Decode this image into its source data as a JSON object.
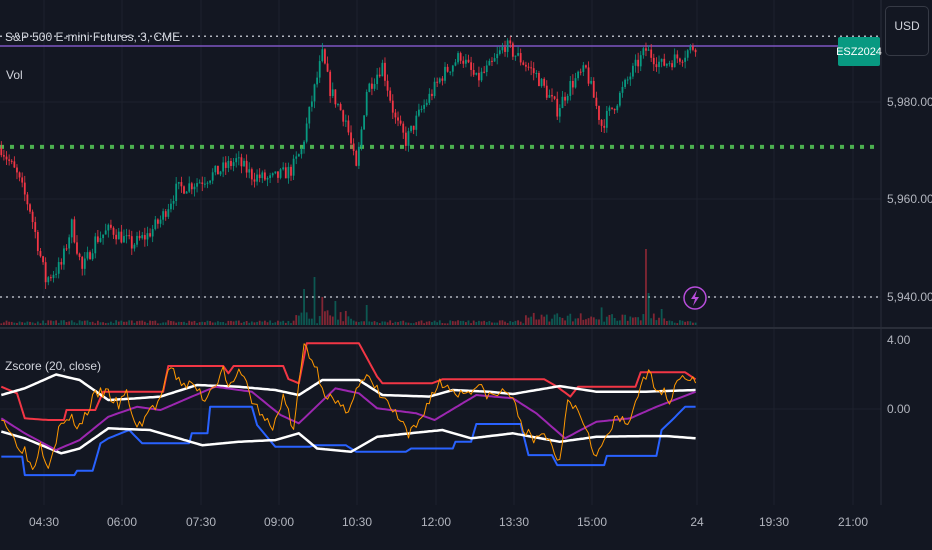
{
  "header": {
    "symbol_legend": "S&P 500 E-mini Futures, 3, CME",
    "volume_legend": "Vol",
    "indicator_legend": "Zscore (20, close)"
  },
  "symbol_tag": "ESZ2024",
  "currency_button": "USD",
  "colors": {
    "up": "#089981",
    "down": "#f23645",
    "upper": "#f23645",
    "lower": "#2962ff",
    "band": "#ffffff",
    "mean": "#9c27b0",
    "zscore": "#ff9800",
    "level": "#4caf50",
    "background": "#131722"
  },
  "price_axis": {
    "labels": [
      "5,980.00",
      "5,960.00",
      "5,940.00"
    ]
  },
  "zscore_axis": {
    "labels": [
      "4.00",
      "0.00"
    ]
  },
  "time_axis": {
    "labels": [
      "04:30",
      "06:00",
      "07:30",
      "09:00",
      "10:30",
      "12:00",
      "13:30",
      "15:00",
      "24",
      "19:30",
      "21:00"
    ]
  },
  "chart_data": [
    {
      "type": "candlestick",
      "title": "S&P 500 E-mini Futures, 3, CME",
      "x_unit": "3-minute bar index",
      "ylim": [
        5932,
        5998
      ],
      "close_keypoints": [
        [
          0,
          5970.6
        ],
        [
          6,
          5965
        ],
        [
          11,
          5958
        ],
        [
          17,
          5943.5
        ],
        [
          23,
          5946.6
        ],
        [
          27,
          5954.8
        ],
        [
          31,
          5945.5
        ],
        [
          36,
          5951.7
        ],
        [
          42,
          5954
        ],
        [
          50,
          5950.7
        ],
        [
          56,
          5952.7
        ],
        [
          61,
          5955.8
        ],
        [
          67,
          5962
        ],
        [
          77,
          5964
        ],
        [
          84,
          5966
        ],
        [
          90,
          5968
        ],
        [
          96,
          5965
        ],
        [
          103,
          5964
        ],
        [
          111,
          5966
        ],
        [
          115,
          5970
        ],
        [
          119,
          5980.4
        ],
        [
          123,
          5989.6
        ],
        [
          126,
          5982.5
        ],
        [
          132,
          5976.3
        ],
        [
          136,
          5966
        ],
        [
          140,
          5982.5
        ],
        [
          146,
          5987.6
        ],
        [
          151,
          5976.3
        ],
        [
          155,
          5972
        ],
        [
          161,
          5978.4
        ],
        [
          169,
          5985.5
        ],
        [
          176,
          5989.6
        ],
        [
          182,
          5984.5
        ],
        [
          188,
          5987.6
        ],
        [
          193,
          5991.7
        ],
        [
          199,
          5988.7
        ],
        [
          205,
          5985.5
        ],
        [
          213,
          5978.4
        ],
        [
          218,
          5983.5
        ],
        [
          224,
          5986.6
        ],
        [
          230,
          5975.3
        ],
        [
          236,
          5980.4
        ],
        [
          241,
          5985.5
        ],
        [
          247,
          5990.7
        ],
        [
          253,
          5987.6
        ],
        [
          261,
          5989.6
        ],
        [
          266,
          5991.7
        ]
      ],
      "horizontal_levels": [
        {
          "price": 5993.5,
          "style": "dotted",
          "color": "#b2b5be"
        },
        {
          "price": 5991.5,
          "style": "solid",
          "color": "#7e57c2"
        },
        {
          "price": 5970.8,
          "style": "dotted",
          "color": "#4caf50"
        },
        {
          "price": 5940.0,
          "style": "dotted",
          "color": "#b2b5be"
        }
      ],
      "volume_spikes": [
        [
          116,
          0.45
        ],
        [
          120,
          0.6
        ],
        [
          123,
          0.35
        ],
        [
          128,
          0.3
        ],
        [
          140,
          0.25
        ],
        [
          230,
          0.22
        ],
        [
          247,
          0.95
        ],
        [
          248,
          0.4
        ],
        [
          253,
          0.2
        ]
      ]
    },
    {
      "type": "line",
      "title": "Zscore (20, close)",
      "ylim": [
        -5.5,
        4.5
      ],
      "series": [
        {
          "name": "upper",
          "points": [
            [
              0,
              1.29
            ],
            [
              6,
              0.91
            ],
            [
              9,
              -0.54
            ],
            [
              18,
              -0.64
            ],
            [
              24,
              -0.64
            ],
            [
              25,
              -0.06
            ],
            [
              36,
              -0.06
            ],
            [
              39,
              1.0
            ],
            [
              62,
              1.0
            ],
            [
              64,
              2.49
            ],
            [
              85,
              2.49
            ],
            [
              87,
              2.07
            ],
            [
              89,
              2.49
            ],
            [
              108,
              2.49
            ],
            [
              110,
              1.74
            ],
            [
              114,
              1.49
            ],
            [
              117,
              3.81
            ],
            [
              137,
              3.81
            ],
            [
              144,
              1.88
            ],
            [
              146,
              1.49
            ],
            [
              165,
              1.49
            ],
            [
              169,
              1.72
            ],
            [
              208,
              1.72
            ],
            [
              213,
              1.29
            ],
            [
              218,
              0.72
            ],
            [
              221,
              1.29
            ],
            [
              243,
              1.29
            ],
            [
              245,
              2.13
            ],
            [
              262,
              2.13
            ],
            [
              266,
              1.72
            ]
          ]
        },
        {
          "name": "lower",
          "points": [
            [
              0,
              -2.76
            ],
            [
              8,
              -2.76
            ],
            [
              9,
              -3.83
            ],
            [
              28,
              -3.83
            ],
            [
              29,
              -3.58
            ],
            [
              35,
              -3.58
            ],
            [
              38,
              -1.99
            ],
            [
              41,
              -1.7
            ],
            [
              49,
              -1.22
            ],
            [
              54,
              -1.99
            ],
            [
              72,
              -1.99
            ],
            [
              73,
              -1.41
            ],
            [
              79,
              -1.41
            ],
            [
              80,
              0.13
            ],
            [
              96,
              0.13
            ],
            [
              98,
              -0.93
            ],
            [
              105,
              -2.19
            ],
            [
              118,
              -2.19
            ],
            [
              120,
              -2.1
            ],
            [
              132,
              -2.1
            ],
            [
              136,
              -2.48
            ],
            [
              155,
              -2.48
            ],
            [
              157,
              -2.29
            ],
            [
              173,
              -2.29
            ],
            [
              174,
              -1.9
            ],
            [
              180,
              -1.9
            ],
            [
              182,
              -0.87
            ],
            [
              199,
              -0.87
            ],
            [
              202,
              -2.67
            ],
            [
              211,
              -2.67
            ],
            [
              213,
              -3.25
            ],
            [
              231,
              -3.25
            ],
            [
              232,
              -2.72
            ],
            [
              251,
              -2.72
            ],
            [
              253,
              -1.22
            ],
            [
              257,
              -0.64
            ],
            [
              262,
              0.13
            ],
            [
              266,
              0.13
            ]
          ]
        },
        {
          "name": "upper_band",
          "points": [
            [
              0,
              0.81
            ],
            [
              9,
              1.2
            ],
            [
              21,
              2.0
            ],
            [
              30,
              1.68
            ],
            [
              41,
              0.52
            ],
            [
              52,
              0.62
            ],
            [
              61,
              0.72
            ],
            [
              75,
              1.39
            ],
            [
              91,
              1.29
            ],
            [
              105,
              1.1
            ],
            [
              114,
              0.81
            ],
            [
              123,
              1.68
            ],
            [
              137,
              1.68
            ],
            [
              146,
              0.81
            ],
            [
              164,
              0.72
            ],
            [
              173,
              1.1
            ],
            [
              187,
              1.0
            ],
            [
              196,
              0.87
            ],
            [
              205,
              1.1
            ],
            [
              214,
              1.33
            ],
            [
              228,
              1.0
            ],
            [
              246,
              1.0
            ],
            [
              266,
              1.1
            ]
          ]
        },
        {
          "name": "lower_band",
          "points": [
            [
              0,
              -1.31
            ],
            [
              9,
              -1.7
            ],
            [
              23,
              -2.57
            ],
            [
              30,
              -2.29
            ],
            [
              41,
              -1.12
            ],
            [
              57,
              -1.22
            ],
            [
              68,
              -1.7
            ],
            [
              77,
              -2.1
            ],
            [
              91,
              -1.9
            ],
            [
              105,
              -1.8
            ],
            [
              114,
              -1.41
            ],
            [
              121,
              -2.29
            ],
            [
              134,
              -2.48
            ],
            [
              144,
              -1.61
            ],
            [
              159,
              -1.37
            ],
            [
              169,
              -1.22
            ],
            [
              180,
              -1.7
            ],
            [
              196,
              -1.41
            ],
            [
              214,
              -1.9
            ],
            [
              228,
              -1.61
            ],
            [
              246,
              -1.57
            ],
            [
              255,
              -1.57
            ],
            [
              266,
              -1.7
            ]
          ]
        },
        {
          "name": "mean",
          "points": [
            [
              0,
              -0.54
            ],
            [
              9,
              -1.41
            ],
            [
              21,
              -2.38
            ],
            [
              30,
              -1.8
            ],
            [
              41,
              -0.45
            ],
            [
              52,
              0.13
            ],
            [
              61,
              -0.06
            ],
            [
              73,
              0.72
            ],
            [
              82,
              1.29
            ],
            [
              96,
              1.0
            ],
            [
              107,
              -0.35
            ],
            [
              114,
              -0.83
            ],
            [
              128,
              1.2
            ],
            [
              137,
              0.91
            ],
            [
              144,
              0.04
            ],
            [
              159,
              -0.25
            ],
            [
              166,
              -0.64
            ],
            [
              182,
              0.81
            ],
            [
              196,
              0.62
            ],
            [
              205,
              -0.25
            ],
            [
              216,
              -1.7
            ],
            [
              228,
              -0.74
            ],
            [
              241,
              -0.54
            ],
            [
              251,
              0.13
            ],
            [
              266,
              1.0
            ]
          ]
        },
        {
          "name": "zscore",
          "points": [
            [
              0,
              -0.3
            ],
            [
              5,
              -1.8
            ],
            [
              9,
              -2.4
            ],
            [
              12,
              -3.5
            ],
            [
              15,
              -2.0
            ],
            [
              18,
              -3.2
            ],
            [
              22,
              -1.2
            ],
            [
              26,
              -0.5
            ],
            [
              30,
              -1.0
            ],
            [
              36,
              0.8
            ],
            [
              40,
              1.0
            ],
            [
              45,
              0.2
            ],
            [
              48,
              0.9
            ],
            [
              52,
              -1.2
            ],
            [
              56,
              -0.2
            ],
            [
              60,
              0.3
            ],
            [
              63,
              1.5
            ],
            [
              65,
              2.4
            ],
            [
              68,
              1.6
            ],
            [
              74,
              1.3
            ],
            [
              78,
              0.6
            ],
            [
              82,
              1.6
            ],
            [
              85,
              2.2
            ],
            [
              88,
              1.2
            ],
            [
              92,
              2.3
            ],
            [
              96,
              0.5
            ],
            [
              100,
              -0.4
            ],
            [
              104,
              -1.2
            ],
            [
              108,
              0.8
            ],
            [
              112,
              -1.3
            ],
            [
              116,
              3.8
            ],
            [
              120,
              2.6
            ],
            [
              124,
              1.0
            ],
            [
              128,
              0.3
            ],
            [
              132,
              -0.2
            ],
            [
              136,
              1.2
            ],
            [
              140,
              1.8
            ],
            [
              146,
              0.7
            ],
            [
              152,
              -0.5
            ],
            [
              156,
              -1.6
            ],
            [
              160,
              -0.8
            ],
            [
              164,
              0.6
            ],
            [
              168,
              1.5
            ],
            [
              172,
              1.2
            ],
            [
              176,
              0.9
            ],
            [
              182,
              1.3
            ],
            [
              188,
              0.7
            ],
            [
              194,
              1.1
            ],
            [
              200,
              -1.0
            ],
            [
              204,
              -2.0
            ],
            [
              208,
              -1.3
            ],
            [
              212,
              -2.5
            ],
            [
              214,
              -3.0
            ],
            [
              217,
              0.8
            ],
            [
              220,
              0.1
            ],
            [
              224,
              -0.9
            ],
            [
              228,
              -2.8
            ],
            [
              232,
              -1.6
            ],
            [
              236,
              -0.5
            ],
            [
              240,
              -1.0
            ],
            [
              244,
              1.0
            ],
            [
              248,
              2.0
            ],
            [
              252,
              1.2
            ],
            [
              256,
              0.6
            ],
            [
              260,
              2.0
            ],
            [
              264,
              1.8
            ],
            [
              266,
              1.4
            ]
          ]
        }
      ]
    }
  ]
}
